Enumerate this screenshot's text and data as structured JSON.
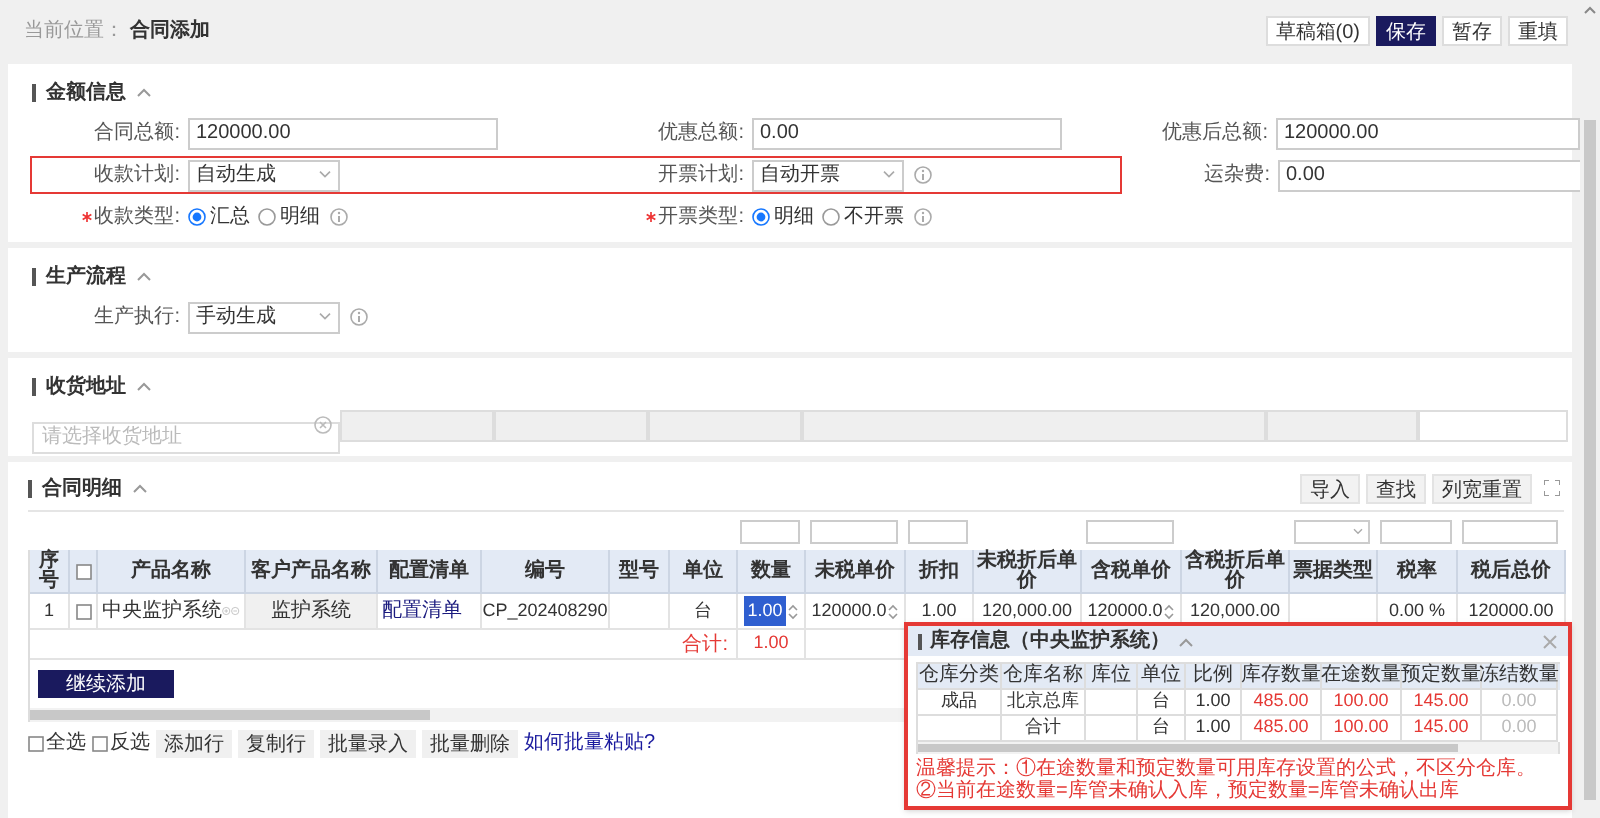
{
  "breadcrumb": {
    "label": "当前位置：",
    "current": "合同添加"
  },
  "toolbar": [
    {
      "label": "草稿箱(0)",
      "primary": false
    },
    {
      "label": "保存",
      "primary": true
    },
    {
      "label": "暂存",
      "primary": false
    },
    {
      "label": "重填",
      "primary": false
    }
  ],
  "amount_section": {
    "title": "金额信息",
    "expanded": true,
    "rows": [
      {
        "fields": [
          {
            "label": "合同总额:",
            "kind": "input",
            "value": "120000.00",
            "required": false,
            "info": false,
            "highlighted": false
          },
          {
            "label": "优惠总额:",
            "kind": "input",
            "value": "0.00",
            "required": false,
            "info": false,
            "highlighted": false
          },
          {
            "label": "优惠后总额:",
            "kind": "input",
            "value": "120000.00",
            "required": false,
            "info": false,
            "highlighted": false
          }
        ]
      },
      {
        "fields": [
          {
            "label": "收款计划:",
            "kind": "select",
            "value": "自动生成",
            "required": false,
            "info": false,
            "highlighted": true
          },
          {
            "label": "开票计划:",
            "kind": "select",
            "value": "自动开票",
            "required": false,
            "info": true,
            "highlighted": true
          },
          {
            "label": "运杂费:",
            "kind": "input",
            "value": "0.00",
            "required": false,
            "info": false,
            "highlighted": false
          }
        ]
      },
      {
        "fields": [
          {
            "label": "收款类型:",
            "kind": "radio",
            "required": true,
            "info": true,
            "highlighted": false,
            "options": [
              {
                "label": "汇总",
                "selected": true
              },
              {
                "label": "明细",
                "selected": false
              }
            ]
          },
          {
            "label": "开票类型:",
            "kind": "radio",
            "required": true,
            "info": true,
            "highlighted": false,
            "options": [
              {
                "label": "明细",
                "selected": true
              },
              {
                "label": "不开票",
                "selected": false
              }
            ]
          }
        ]
      }
    ]
  },
  "production_section": {
    "title": "生产流程",
    "expanded": true,
    "fields": [
      {
        "label": "生产执行:",
        "kind": "select",
        "value": "手动生成",
        "required": false,
        "info": true,
        "highlighted": false
      }
    ]
  },
  "address_section": {
    "title": "收货地址",
    "expanded": true,
    "placeholder": "请选择收货地址"
  },
  "detail_section": {
    "title": "合同明细",
    "expanded": true,
    "actions": [
      "导入",
      "查找",
      "列宽重置"
    ],
    "filters": [
      {
        "kind": "none"
      },
      {
        "kind": "none"
      },
      {
        "kind": "none"
      },
      {
        "kind": "none"
      },
      {
        "kind": "none"
      },
      {
        "kind": "none"
      },
      {
        "kind": "none"
      },
      {
        "kind": "none"
      },
      {
        "kind": "input"
      },
      {
        "kind": "input"
      },
      {
        "kind": "input"
      },
      {
        "kind": "none"
      },
      {
        "kind": "input"
      },
      {
        "kind": "none"
      },
      {
        "kind": "select"
      },
      {
        "kind": "input"
      },
      {
        "kind": "input"
      }
    ],
    "columns": [
      {
        "kind": "label",
        "label": "序号"
      },
      {
        "kind": "checkbox",
        "checked": false
      },
      {
        "kind": "label",
        "label": "产品名称"
      },
      {
        "kind": "label",
        "label": "客户产品名称"
      },
      {
        "kind": "label",
        "label": "配置清单"
      },
      {
        "kind": "label",
        "label": "编号"
      },
      {
        "kind": "label",
        "label": "型号"
      },
      {
        "kind": "label",
        "label": "单位"
      },
      {
        "kind": "label",
        "label": "数量"
      },
      {
        "kind": "label",
        "label": "未税单价"
      },
      {
        "kind": "label",
        "label": "折扣"
      },
      {
        "kind": "label",
        "label": "未税折后单价"
      },
      {
        "kind": "label",
        "label": "含税单价"
      },
      {
        "kind": "label",
        "label": "含税折后单价"
      },
      {
        "kind": "label",
        "label": "票据类型"
      },
      {
        "kind": "label",
        "label": "税率"
      },
      {
        "kind": "label",
        "label": "税后总价"
      }
    ],
    "rows": [
      {
        "cells": [
          {
            "kind": "text",
            "text": "1"
          },
          {
            "kind": "checkbox",
            "checked": false
          },
          {
            "kind": "product",
            "text": "中央监护系统"
          },
          {
            "kind": "readonly",
            "text": "监护系统"
          },
          {
            "kind": "link",
            "text": "配置清单"
          },
          {
            "kind": "text",
            "text": "CP_202408290"
          },
          {
            "kind": "empty",
            "text": ""
          },
          {
            "kind": "text",
            "text": "台"
          },
          {
            "kind": "active_input",
            "text": "1.00"
          },
          {
            "kind": "number_input",
            "text": "120000.0"
          },
          {
            "kind": "text",
            "text": "1.00"
          },
          {
            "kind": "text",
            "text": "120,000.00"
          },
          {
            "kind": "number_input",
            "text": "120000.0"
          },
          {
            "kind": "text",
            "text": "120,000.00"
          },
          {
            "kind": "empty",
            "text": ""
          },
          {
            "kind": "text",
            "text": "0.00 %"
          },
          {
            "kind": "text",
            "text": "120000.00"
          }
        ]
      }
    ],
    "total": {
      "label": "合计:",
      "quantity": "1.00"
    },
    "add_button": "继续添加",
    "select_options": [
      {
        "label": "全选",
        "checked": false
      },
      {
        "label": "反选",
        "checked": false
      }
    ],
    "row_buttons": [
      "添加行",
      "复制行",
      "批量录入",
      "批量删除"
    ],
    "help_link": "如何批量粘贴?"
  },
  "stock_popup": {
    "title": "库存信息（中央监护系统）",
    "expanded": true,
    "columns": [
      {
        "label": "仓库分类",
        "kind": "normal"
      },
      {
        "label": "仓库名称",
        "kind": "normal"
      },
      {
        "label": "库位",
        "kind": "normal"
      },
      {
        "label": "单位",
        "kind": "normal"
      },
      {
        "label": "比例",
        "kind": "normal"
      },
      {
        "label": "库存数量",
        "kind": "alert"
      },
      {
        "label": "在途数量",
        "kind": "alert"
      },
      {
        "label": "预定数量",
        "kind": "alert"
      },
      {
        "label": "冻结数量",
        "kind": "muted"
      }
    ],
    "rows": [
      [
        "成品",
        "北京总库",
        "",
        "台",
        "1.00",
        "485.00",
        "100.00",
        "145.00",
        "0.00"
      ],
      [
        "",
        "合计",
        "",
        "台",
        "1.00",
        "485.00",
        "100.00",
        "145.00",
        "0.00"
      ]
    ],
    "notes": [
      "温馨提示：①在途数量和预定数量可用库存设置的公式，不区分仓库。",
      "②当前在途数量=库管未确认入库，预定数量=库管未确认出库"
    ]
  }
}
